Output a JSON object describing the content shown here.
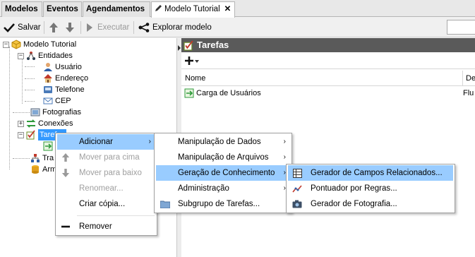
{
  "tabs": [
    {
      "label": "Modelos"
    },
    {
      "label": "Eventos"
    },
    {
      "label": "Agendamentos"
    },
    {
      "label": "Modelo Tutorial",
      "close": "✕"
    }
  ],
  "toolbar": {
    "save_label": "Salvar",
    "execute_label": "Executar",
    "explore_label": "Explorar modelo"
  },
  "tree": {
    "root": "Modelo Tutorial",
    "entidades": "Entidades",
    "usuario": "Usuário",
    "endereco": "Endereço",
    "telefone": "Telefone",
    "cep": "CEP",
    "fotografias": "Fotografias",
    "conexoes": "Conexões",
    "tarefas": "Tarefas",
    "tra": "Tra",
    "arm": "Arm"
  },
  "right": {
    "title": "Tarefas",
    "col_name": "Nome",
    "col_desc": "De",
    "rows": [
      {
        "name": "Carga de Usuários",
        "desc": "Flu"
      }
    ]
  },
  "menu1": {
    "add": "Adicionar",
    "move_up": "Mover para cima",
    "move_down": "Mover para baixo",
    "rename": "Renomear...",
    "copy": "Criar cópia...",
    "remove": "Remover"
  },
  "menu2": {
    "data": "Manipulação de Dados",
    "files": "Manipulação de Arquivos",
    "knowledge": "Geração de Conhecimento",
    "admin": "Administração",
    "subgroup": "Subgrupo de Tarefas..."
  },
  "menu3": {
    "related": "Gerador de Campos Relacionados...",
    "rules": "Pontuador por Regras...",
    "photo": "Gerador de Fotografia..."
  },
  "colors": {
    "highlight": "#99ccff",
    "selection": "#3399ff",
    "header": "#5a5a5a"
  }
}
